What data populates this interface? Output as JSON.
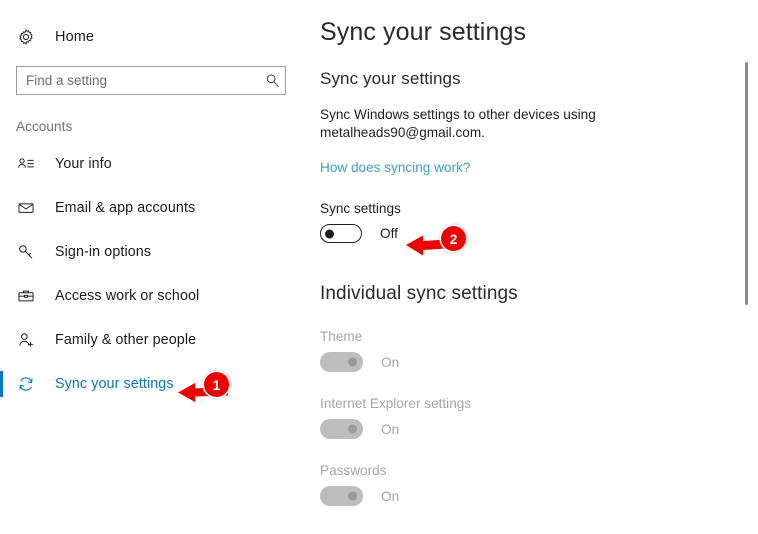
{
  "sidebar": {
    "home": {
      "label": "Home",
      "icon": "gear-icon"
    },
    "search": {
      "placeholder": "Find a setting",
      "value": "",
      "icon": "search-icon"
    },
    "section_label": "Accounts",
    "items": [
      {
        "label": "Your info",
        "icon": "contact-card-icon",
        "selected": false
      },
      {
        "label": "Email & app accounts",
        "icon": "envelope-icon",
        "selected": false
      },
      {
        "label": "Sign-in options",
        "icon": "key-icon",
        "selected": false
      },
      {
        "label": "Access work or school",
        "icon": "briefcase-icon",
        "selected": false
      },
      {
        "label": "Family & other people",
        "icon": "person-add-icon",
        "selected": false
      },
      {
        "label": "Sync your settings",
        "icon": "sync-icon",
        "selected": true
      }
    ]
  },
  "main": {
    "page_title": "Sync your settings",
    "sub_head": "Sync your settings",
    "description": "Sync Windows settings to other devices using metalheads90@gmail.com.",
    "link": "How does syncing work?",
    "sync_setting": {
      "label": "Sync settings",
      "state": "Off",
      "enabled": true
    },
    "group_head": "Individual sync settings",
    "individual": [
      {
        "label": "Theme",
        "state": "On",
        "disabled": true
      },
      {
        "label": "Internet Explorer settings",
        "state": "On",
        "disabled": true
      },
      {
        "label": "Passwords",
        "state": "On",
        "disabled": true
      }
    ]
  },
  "annotations": [
    {
      "number": "1",
      "color": "#ee0000"
    },
    {
      "number": "2",
      "color": "#ee0000"
    }
  ],
  "colors": {
    "accent": "#0b76c8",
    "link": "#3e9ddb",
    "annotation": "#ee0000",
    "disabled_text": "#a6a6a6"
  }
}
